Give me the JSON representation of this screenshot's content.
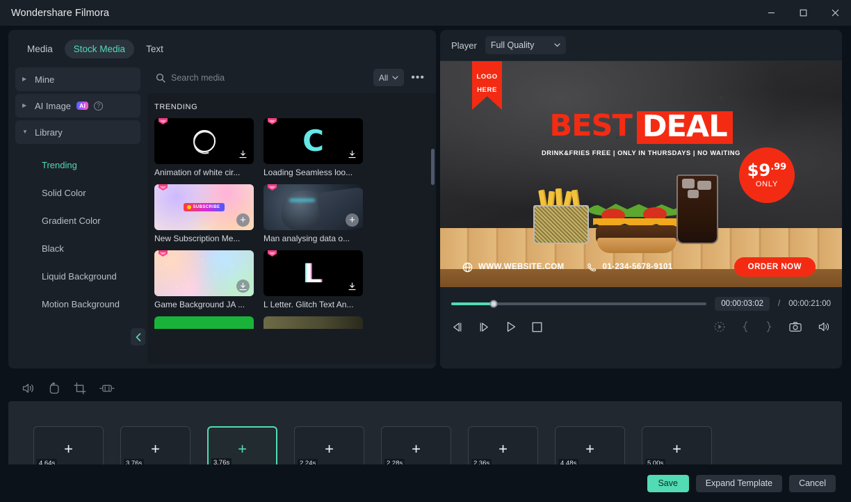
{
  "window": {
    "title": "Wondershare Filmora",
    "controls": {
      "minimize": "minimize-icon",
      "maximize": "maximize-icon",
      "close": "close-icon"
    }
  },
  "left_panel": {
    "tabs": [
      {
        "label": "Media",
        "active": false
      },
      {
        "label": "Stock Media",
        "active": true
      },
      {
        "label": "Text",
        "active": false
      }
    ],
    "sidebar": {
      "groups": [
        {
          "label": "Mine",
          "expanded": false
        },
        {
          "label": "AI Image",
          "expanded": false,
          "badge": "AI",
          "help": "help-icon"
        },
        {
          "label": "Library",
          "expanded": true
        }
      ],
      "items": [
        {
          "label": "Trending",
          "active": true
        },
        {
          "label": "Solid Color",
          "active": false
        },
        {
          "label": "Gradient Color",
          "active": false
        },
        {
          "label": "Black",
          "active": false
        },
        {
          "label": "Liquid Background",
          "active": false
        },
        {
          "label": "Motion Background",
          "active": false
        }
      ],
      "collapse_icon": "chevron-left-icon"
    },
    "search": {
      "placeholder": "Search media",
      "value": "",
      "filter_label": "All",
      "more_label": "•••"
    },
    "section_title": "TRENDING",
    "media": [
      {
        "title": "Animation of white cir...",
        "action": "download",
        "badge": "premium"
      },
      {
        "title": "Loading Seamless loo...",
        "action": "download",
        "badge": "premium"
      },
      {
        "title": "New Subscription Me...",
        "action": "add",
        "badge": "premium"
      },
      {
        "title": "Man analysing data o...",
        "action": "add",
        "badge": "premium"
      },
      {
        "title": "Game Background JA ...",
        "action": "download-filled",
        "badge": "premium"
      },
      {
        "title": "L Letter. Glitch Text An...",
        "action": "download",
        "badge": "premium"
      }
    ]
  },
  "player": {
    "label": "Player",
    "quality": "Full Quality",
    "preview": {
      "ribbon_line1": "LOGO",
      "ribbon_line2": "HERE",
      "headline_1": "BEST",
      "headline_2": "DEAL",
      "subline": "DRINK&FRIES FREE | ONLY IN THURSDAYS | NO WAITING",
      "price_amount": "$9",
      "price_cents": ".99",
      "price_note": "ONLY",
      "website": "WWW.WEBSITE.COM",
      "phone": "01-234-5678-9101",
      "cta": "ORDER NOW"
    },
    "current_time": "00:00:03:02",
    "separator": "/",
    "total_time": "00:00:21:00",
    "progress_percent": 16.5,
    "controls": {
      "prev_frame": "previous-frame-icon",
      "next_frame": "next-frame-icon",
      "play": "play-icon",
      "stop": "stop-icon",
      "record": "record-icon",
      "mark_in": "mark-in-icon",
      "mark_out": "mark-out-icon",
      "snapshot": "snapshot-icon",
      "volume": "volume-icon"
    }
  },
  "timeline_toolbar": [
    {
      "icon": "volume-icon"
    },
    {
      "icon": "rotate-icon"
    },
    {
      "icon": "crop-icon"
    },
    {
      "icon": "speed-icon"
    }
  ],
  "timeline": {
    "clips": [
      {
        "duration": "4.64s",
        "selected": false
      },
      {
        "duration": "3.76s",
        "selected": false
      },
      {
        "duration": "3.76s",
        "selected": true
      },
      {
        "duration": "2.24s",
        "selected": false
      },
      {
        "duration": "2.28s",
        "selected": false
      },
      {
        "duration": "2.36s",
        "selected": false
      },
      {
        "duration": "4.48s",
        "selected": false
      },
      {
        "duration": "5.00s",
        "selected": false
      }
    ],
    "add_icon": "plus-icon"
  },
  "footer": {
    "save": "Save",
    "expand_template": "Expand Template",
    "cancel": "Cancel"
  },
  "colors": {
    "accent": "#52dbb4",
    "ad_red": "#f42b13",
    "panel_bg": "#1a2028",
    "window_bg": "#0c1219",
    "timeline_bg": "#212830"
  }
}
